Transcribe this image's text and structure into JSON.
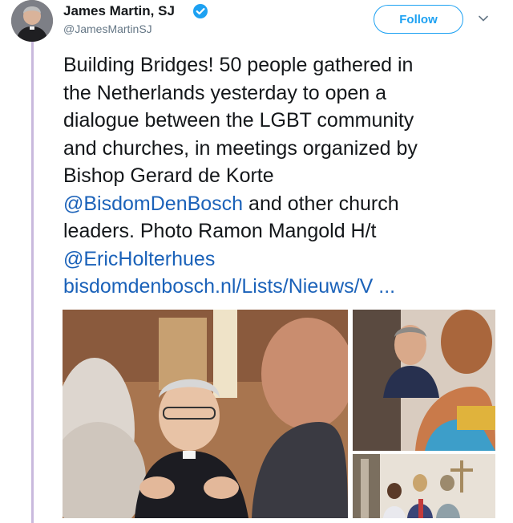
{
  "author": {
    "display_name": "James Martin, SJ",
    "handle": "@JamesMartinSJ",
    "verified": true,
    "avatar_icon": "profile-photo"
  },
  "actions": {
    "follow_label": "Follow",
    "more_icon": "chevron-down-icon"
  },
  "tweet": {
    "line1": "Building Bridges! 50 people gathered in",
    "line2": "the Netherlands yesterday to open a",
    "line3": "dialogue between the LGBT community",
    "line4": "and churches, in meetings organized by",
    "line5": "Bishop Gerard de Korte",
    "mention1": "@BisdomDenBosch",
    "line6_rest": " and other church",
    "line7": "leaders. Photo Ramon Mangold H/t",
    "mention2": "@EricHolterhues",
    "link_text": "bisdomdenbosch.nl/Lists/Nieuws/V",
    "link_ellipsis": "  ..."
  },
  "media": {
    "photo_count": 3
  },
  "colors": {
    "link": "#1b62b9",
    "follow_accent": "#1da1f2",
    "verified": "#1da1f2",
    "thread_line": "#c9b9dd"
  }
}
